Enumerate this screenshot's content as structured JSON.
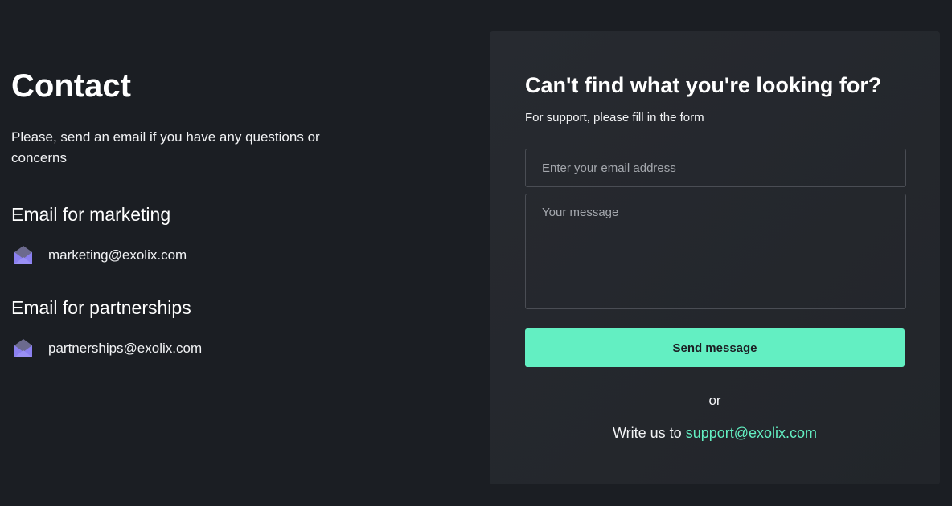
{
  "contact": {
    "title": "Contact",
    "intro": "Please, send an email if you have any questions or concerns",
    "marketing": {
      "heading": "Email for marketing",
      "email": "marketing@exolix.com",
      "icon": "envelope-open-icon"
    },
    "partnerships": {
      "heading": "Email for partnerships",
      "email": "partnerships@exolix.com",
      "icon": "envelope-open-icon"
    }
  },
  "form": {
    "title": "Can't find what you're looking for?",
    "subtitle": "For support, please fill in the form",
    "email_placeholder": "Enter your email address",
    "message_placeholder": "Your message",
    "send_label": "Send message",
    "or_text": "or",
    "write_prefix": "Write us to",
    "support_email": "support@exolix.com"
  },
  "colors": {
    "background": "#1b1e23",
    "card": "#25282d",
    "accent": "#63efc2",
    "icon_purple": "#8b80f0"
  }
}
